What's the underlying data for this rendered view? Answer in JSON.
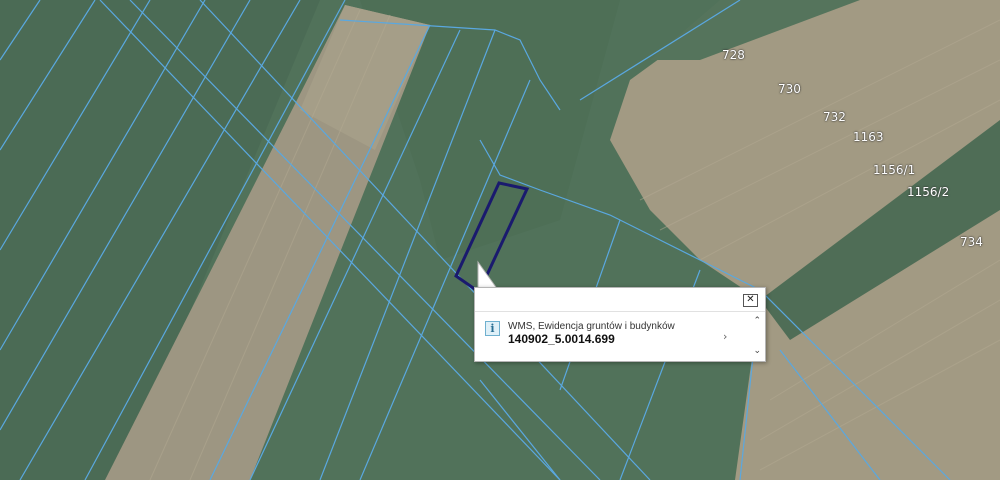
{
  "map": {
    "parcel_labels": [
      {
        "text": "728"
      },
      {
        "text": "730"
      },
      {
        "text": "732"
      },
      {
        "text": "1163"
      },
      {
        "text": "1156/1"
      },
      {
        "text": "1156/2"
      },
      {
        "text": "734"
      }
    ],
    "colors": {
      "parcel_boundary": "#5aa8e0",
      "selected_parcel": "#1a1a6e",
      "meadow": "#51725a",
      "field_dry": "#a39a84",
      "field_strip": "#9a937d"
    }
  },
  "popup": {
    "close_label": "✕",
    "info_icon": "info-icon",
    "layer_name": "WMS, Ewidencja gruntów i budynków",
    "feature_id": "140902_5.0014.699",
    "expand_label": "›",
    "scroll_up_label": "⌃",
    "scroll_down_label": "⌄"
  }
}
